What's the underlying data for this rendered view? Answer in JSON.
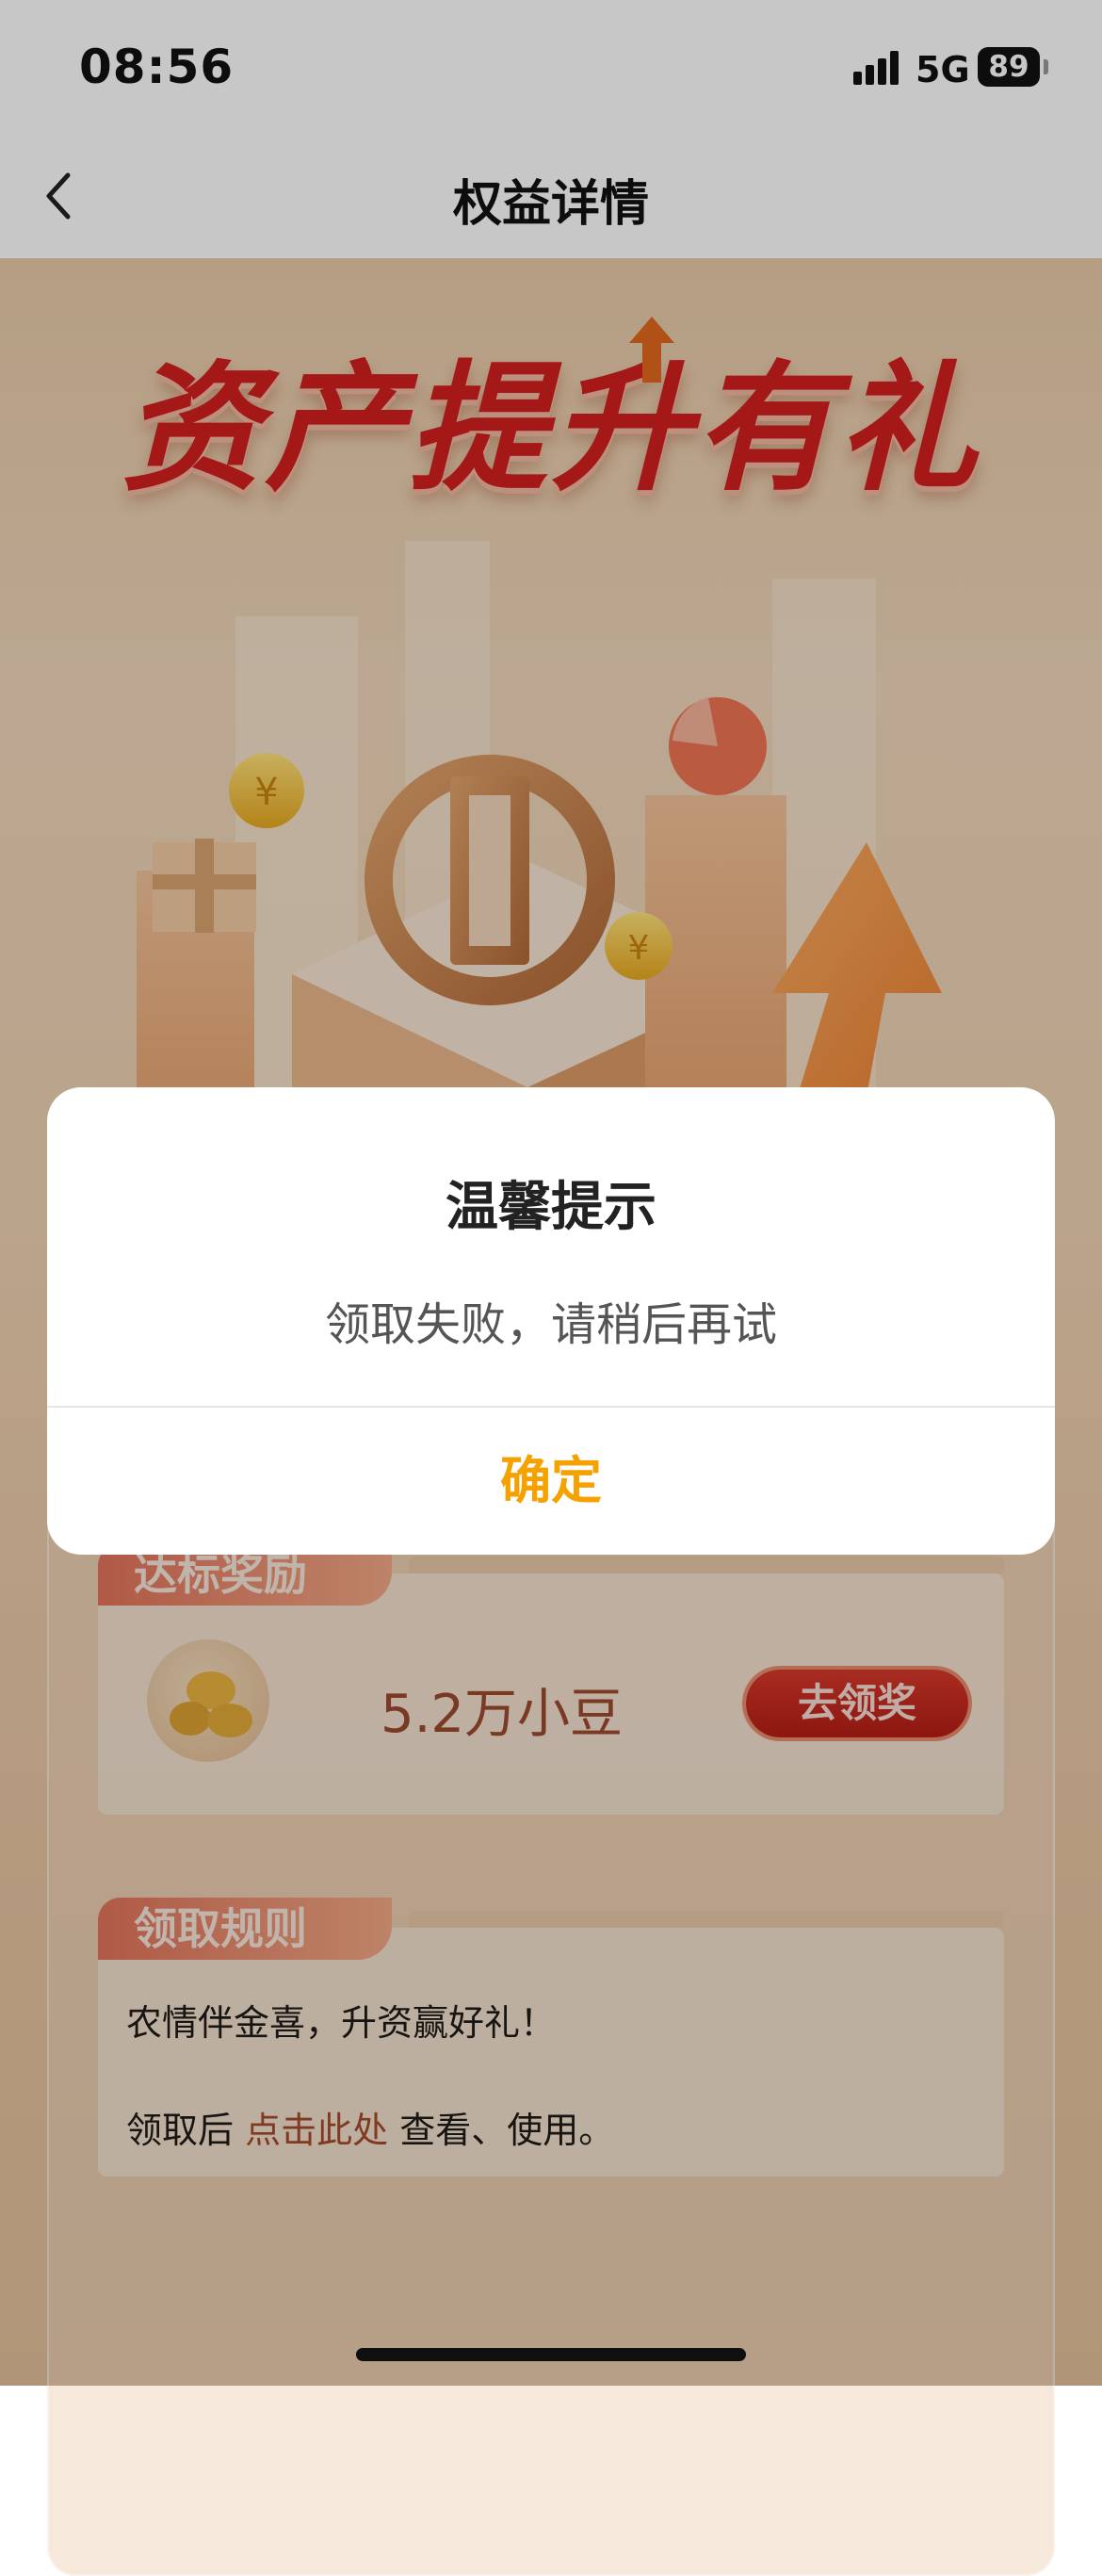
{
  "status_bar": {
    "time": "08:56",
    "network": "5G",
    "battery": "89"
  },
  "nav": {
    "title": "权益详情",
    "back_icon": "chevron-left-icon"
  },
  "banner": {
    "title": "资产提升有礼"
  },
  "reward_section": {
    "tab_label": "达标奖励",
    "reward_text": "5.2万小豆",
    "claim_button": "去领奖"
  },
  "rules_section": {
    "tab_label": "领取规则",
    "line1": "农情伴金喜，升资赢好礼！",
    "line2_prefix": "领取后",
    "line2_link": "点击此处",
    "line2_suffix": "查看、使用。"
  },
  "dialog": {
    "title": "温馨提示",
    "message": "领取失败，请稍后再试",
    "confirm": "确定"
  },
  "colors": {
    "accent": "#f5a100",
    "banner_red": "#d41f1f",
    "button_red": "#c62a1f"
  }
}
